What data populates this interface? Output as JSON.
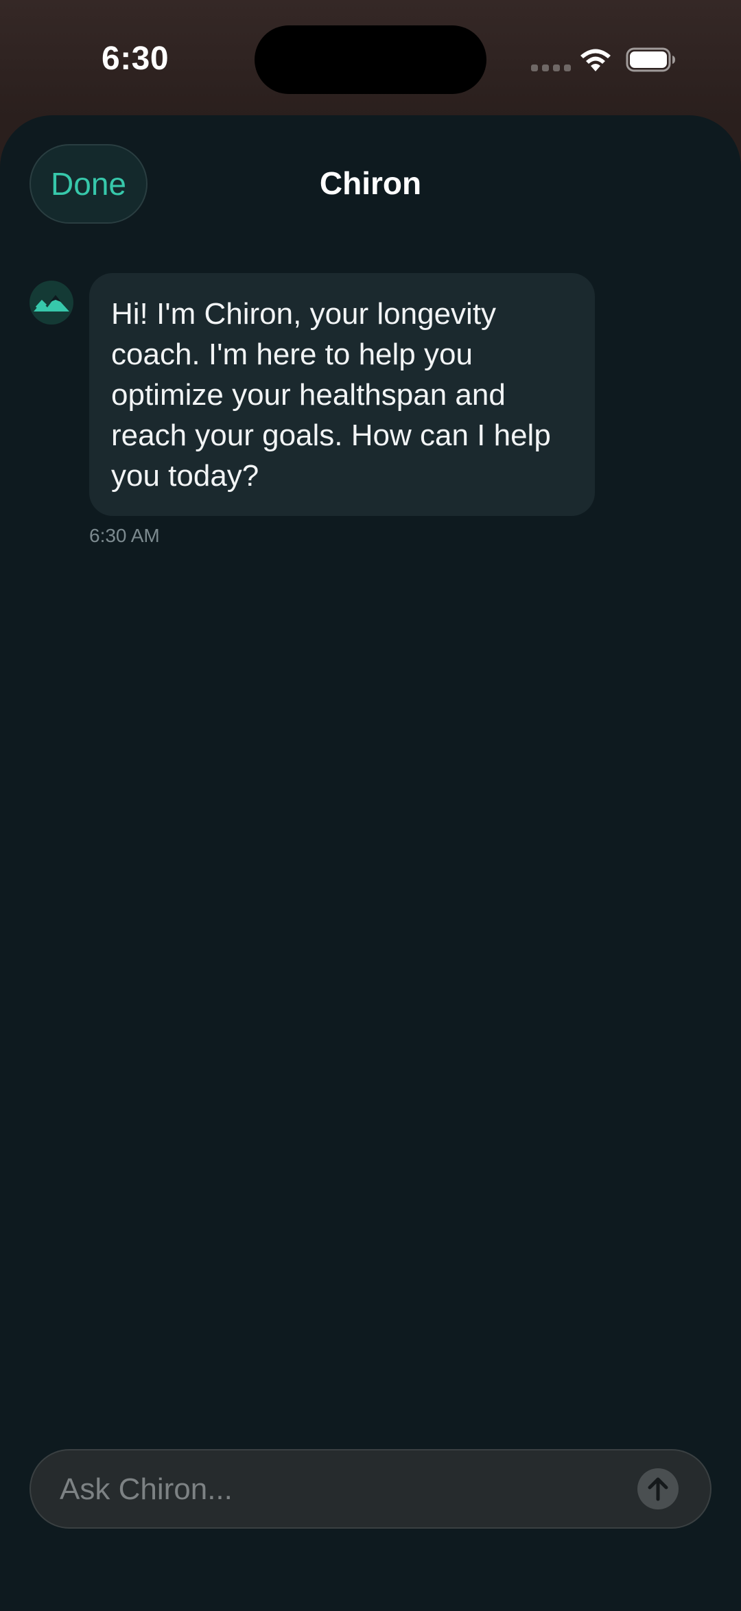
{
  "status_bar": {
    "time": "6:30",
    "icons": [
      "signal-dots-icon",
      "wifi-icon",
      "battery-icon"
    ]
  },
  "header": {
    "done_label": "Done",
    "title": "Chiron"
  },
  "messages": [
    {
      "sender_avatar_icon": "mountain-icon",
      "text": "Hi! I'm Chiron, your longevity coach. I'm here to help you optimize your healthspan and reach your goals. How can I help you today?",
      "time": "6:30 AM"
    }
  ],
  "composer": {
    "placeholder": "Ask Chiron...",
    "value": "",
    "send_icon": "arrow-up-icon"
  },
  "colors": {
    "accent": "#37c8ab",
    "background": "#0e1a1f",
    "bubble": "#1b292e"
  }
}
